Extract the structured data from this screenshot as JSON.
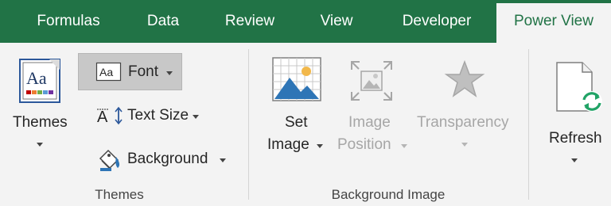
{
  "tabs": [
    {
      "label": "Formulas",
      "active": false
    },
    {
      "label": "Data",
      "active": false
    },
    {
      "label": "Review",
      "active": false
    },
    {
      "label": "View",
      "active": false
    },
    {
      "label": "Developer",
      "active": false
    },
    {
      "label": "Power View",
      "active": true
    }
  ],
  "groups": {
    "themes": {
      "label": "Themes",
      "themes_button": "Themes",
      "font_button": "Font",
      "text_size_button": "Text Size",
      "background_button": "Background",
      "themes_icon_text": "Aa",
      "font_icon_text": "Aa",
      "text_size_icon_text": "A"
    },
    "background_image": {
      "label": "Background Image",
      "set_image_line1": "Set",
      "set_image_line2": "Image",
      "image_position_line1": "Image",
      "image_position_line2": "Position",
      "transparency": "Transparency"
    },
    "refresh": {
      "refresh_button": "Refresh"
    }
  },
  "colors": {
    "tab_bar": "#217346",
    "ribbon_bg": "#f3f3f3",
    "active_tab_text": "#217346",
    "disabled_text": "#a6a6a6",
    "hover_bg": "#c8c8c8"
  },
  "icons": {
    "themes": "themes-icon",
    "font": "font-icon",
    "text_size": "text-size-icon",
    "background": "background-fill-icon",
    "set_image": "picture-icon",
    "image_position": "image-position-icon",
    "transparency": "star-icon",
    "refresh": "refresh-document-icon"
  }
}
